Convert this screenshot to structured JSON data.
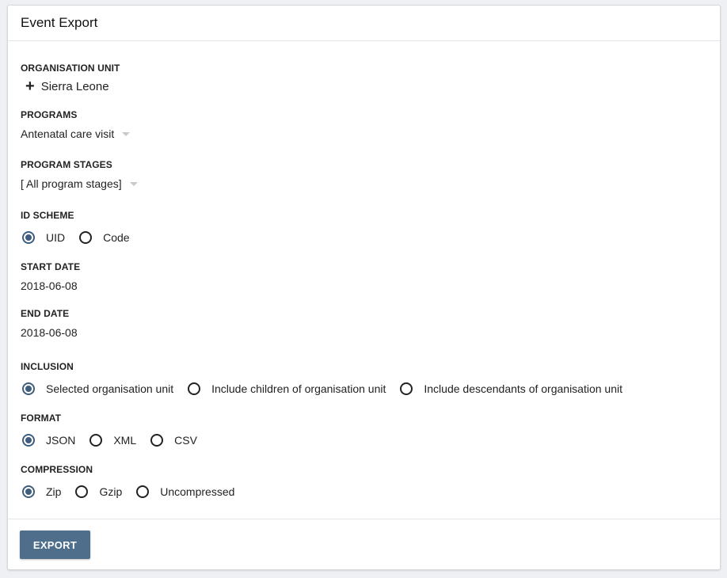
{
  "title": "Event Export",
  "org_unit": {
    "label": "ORGANISATION UNIT",
    "expand_symbol": "+",
    "value": "Sierra Leone"
  },
  "programs": {
    "label": "PROGRAMS",
    "value": "Antenatal care visit"
  },
  "program_stages": {
    "label": "PROGRAM STAGES",
    "value": "[ All program stages]"
  },
  "id_scheme": {
    "label": "ID SCHEME",
    "options": [
      "UID",
      "Code"
    ],
    "selected": "UID"
  },
  "start_date": {
    "label": "START DATE",
    "value": "2018-06-08"
  },
  "end_date": {
    "label": "END DATE",
    "value": "2018-06-08"
  },
  "inclusion": {
    "label": "INCLUSION",
    "options": [
      "Selected organisation unit",
      "Include children of organisation unit",
      "Include descendants of organisation unit"
    ],
    "selected": "Selected organisation unit"
  },
  "format": {
    "label": "FORMAT",
    "options": [
      "JSON",
      "XML",
      "CSV"
    ],
    "selected": "JSON"
  },
  "compression": {
    "label": "COMPRESSION",
    "options": [
      "Zip",
      "Gzip",
      "Uncompressed"
    ],
    "selected": "Zip"
  },
  "export_label": "EXPORT",
  "colors": {
    "accent": "#3f5e7e",
    "button": "#4e6e8c"
  }
}
